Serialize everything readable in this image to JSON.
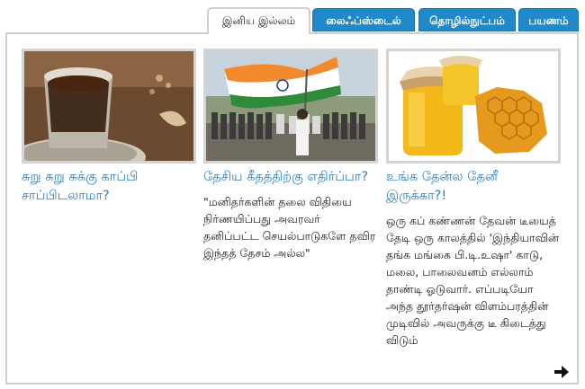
{
  "tabs": [
    {
      "label": "இனிய இல்லம்",
      "active": true
    },
    {
      "label": "லைஃப்ஸ்டைல்",
      "active": false
    },
    {
      "label": "தொழில்நுட்பம்",
      "active": false
    },
    {
      "label": "பயணம்",
      "active": false
    }
  ],
  "cards": [
    {
      "title": "சுறு சுறு  சுக்கு காப்பி சாப்பிடலாமா?",
      "description": "",
      "image": "coffee-tumbler-image"
    },
    {
      "title": "தேசிய கீதத்திற்கு எதிர்ப்பா?",
      "description": "\"மனிதர்களின் தலை விதியை நிர்ணயிப்பது அவரவர் தனிப்பட்ட செயல்பாடுகளே தவிர இந்தத் தேசம் அல்ல\"",
      "image": "students-flag-image"
    },
    {
      "title": "உங்க தேன்ல தேனீ இருக்கா?!",
      "description": "ஒரு கப் கண்ணன் தேவன் டீயைத் தேடி ஒரு காலத்தில் 'இந்தியாவின் தங்க மங்கை பி.டி.உஷா' காடு, மலை, பாலைவனம் எல்லாம் தாண்டி ஓடுவார். எப்படியோ அந்த தூர்தர்ஷன் விளம்பரத்தின் முடிவில் அவருக்கு டீ கிடைத்து விடும்",
      "image": "honey-jar-image"
    }
  ],
  "next_icon": "arrow-right-icon",
  "colors": {
    "tab_blue": "#2089c9",
    "link_blue": "#2c7fc2",
    "border": "#cfcfcf"
  }
}
